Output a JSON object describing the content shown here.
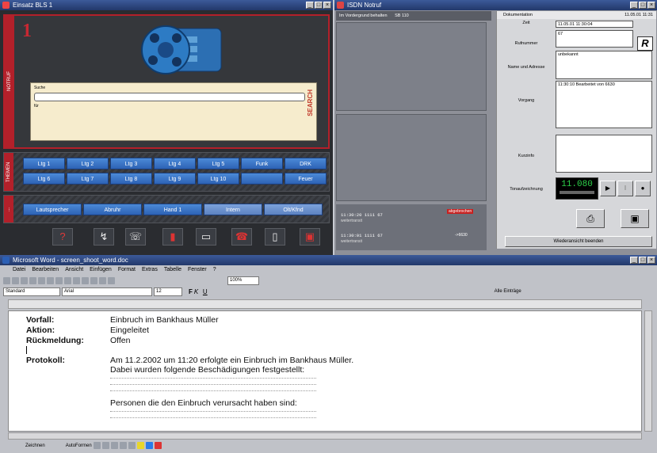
{
  "cmd_app": {
    "title": "Einsatz BLS 1",
    "side_tabs": [
      "NOTRUF",
      "THEMEN",
      "..."
    ],
    "big_number": "1",
    "search": {
      "label": "Suche",
      "label2": "für",
      "side_word": "SEARCH"
    },
    "grid_buttons": [
      "Ltg 1",
      "Ltg 2",
      "Ltg 3",
      "Ltg 4",
      "Ltg 5",
      "Funk",
      "DRK",
      "Ltg 6",
      "Ltg 7",
      "Ltg 8",
      "Ltg 9",
      "Ltg 10",
      "",
      "Feuer"
    ],
    "call_buttons": [
      "Lautsprecher",
      "Abruhr",
      "Hand 1",
      "Intern",
      "Olt/Kfnd"
    ],
    "colors": {
      "accent_red": "#b3202a",
      "button_blue": "#3b76c6"
    }
  },
  "case_app": {
    "title": "ISDN Notruf",
    "top_left_text": "Im Vordergrund behalten",
    "top_left_num": "SB 110",
    "tab_label": "Dokumentation",
    "tab_date": "11.05.01 11:31",
    "logo": "R",
    "fields": [
      {
        "label": "Zeit",
        "value": "11.05.01 11:30:04"
      },
      {
        "label": "Rufnummer",
        "value": "67"
      },
      {
        "label": "Name und Adresse",
        "value": "unbekannt"
      },
      {
        "label": "Vorgang",
        "value": "11:30:10 Bearbeitet von 6630"
      },
      {
        "label": "Kurzinfo",
        "value": ""
      },
      {
        "label": "Tonaufzeichnung",
        "value": ""
      }
    ],
    "timer": "11.080",
    "log_lines": [
      {
        "time": "11:30:20 1111 67",
        "status": "weitertransit",
        "badge": "abgebrochen"
      },
      {
        "time": "11:30:01 1111 67",
        "status": "weitertransit",
        "badge": "->6630"
      }
    ],
    "end_button": "Wiederansicht beenden"
  },
  "word": {
    "title": "Microsoft Word - screen_shoot_word.doc",
    "menu": [
      "Datei",
      "Bearbeiten",
      "Ansicht",
      "Einfügen",
      "Format",
      "Extras",
      "Tabelle",
      "Fenster",
      "?"
    ],
    "style": "Standard",
    "font": "Arial",
    "size": "12",
    "zoom": "100%",
    "show_all": "Alle Einträge",
    "doc": {
      "vorfall_label": "Vorfall:",
      "vorfall": "Einbruch im Bankhaus Müller",
      "aktion_label": "Aktion:",
      "aktion": "Eingeleitet",
      "rueck_label": "Rückmeldung:",
      "rueck": "Offen",
      "protokoll_label": "Protokoll:",
      "protokoll_1": "Am 11.2.2002 um 11:20 erfolgte ein Einbruch im Bankhaus Müller.",
      "protokoll_2": "Dabei wurden folgende Beschädigungen festgestellt:",
      "personen": "Personen die den Einbruch verursacht haben sind:"
    },
    "draw_menu": "Zeichnen",
    "autoformen": "AutoFormen"
  }
}
